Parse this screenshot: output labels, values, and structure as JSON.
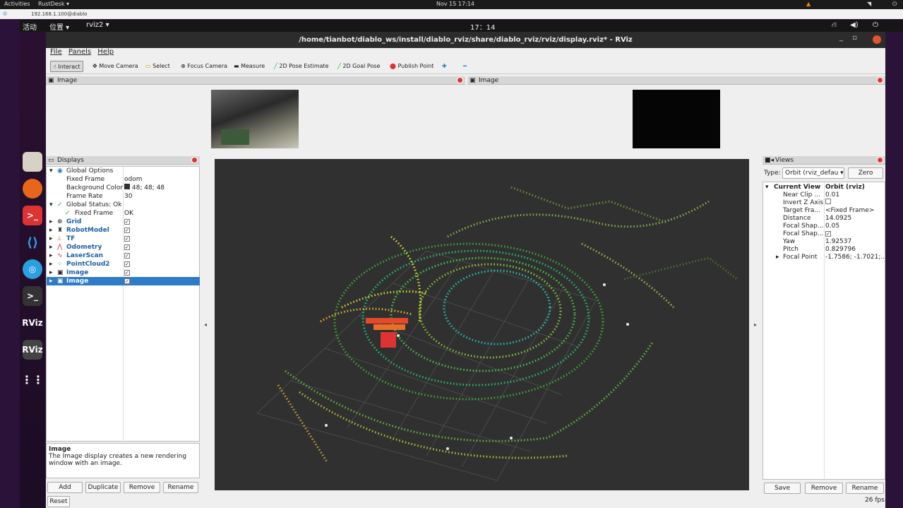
{
  "host": {
    "activities": "Activities",
    "app": "RustDesk ▾",
    "clock": "Nov 15  17:14",
    "address": "192.168.1.100@diablo"
  },
  "gnome": {
    "activities": "活动",
    "places": "位置 ▾",
    "app": "rviz2 ▾",
    "clock": "17：14"
  },
  "window": {
    "title": "/home/tianbot/diablo_ws/install/diablo_rviz/share/diablo_rviz/rviz/display.rviz* - RViz",
    "menu": [
      "File",
      "Panels",
      "Help"
    ],
    "tools": [
      "Interact",
      "Move Camera",
      "Select",
      "Focus Camera",
      "Measure",
      "2D Pose Estimate",
      "2D Goal Pose",
      "Publish Point"
    ]
  },
  "image_panels": [
    "Image",
    "Image"
  ],
  "displays": {
    "title": "Displays",
    "rows": [
      {
        "k": "Global Options",
        "v": ""
      },
      {
        "k": "Fixed Frame",
        "v": "odom"
      },
      {
        "k": "Background Color",
        "v": "48; 48; 48"
      },
      {
        "k": "Frame Rate",
        "v": "30"
      },
      {
        "k": "Global Status: Ok",
        "v": ""
      },
      {
        "k": "Fixed Frame",
        "v": "OK"
      },
      {
        "k": "Grid",
        "v": "✓"
      },
      {
        "k": "RobotModel",
        "v": "✓"
      },
      {
        "k": "TF",
        "v": "✓"
      },
      {
        "k": "Odometry",
        "v": "✓"
      },
      {
        "k": "LaserScan",
        "v": "✓"
      },
      {
        "k": "PointCloud2",
        "v": "✓"
      },
      {
        "k": "Image",
        "v": "✓"
      },
      {
        "k": "Image",
        "v": "✓"
      }
    ],
    "desc_title": "Image",
    "desc_text": "The Image display creates a new rendering window with an image.",
    "buttons": [
      "Add",
      "Duplicate",
      "Remove",
      "Rename"
    ],
    "reset": "Reset"
  },
  "views": {
    "title": "Views",
    "type_label": "Type:",
    "type_value": "Orbit (rviz_defau ▾",
    "zero": "Zero",
    "rows": [
      {
        "k": "Current View",
        "v": "Orbit (rviz)"
      },
      {
        "k": "Near Clip ...",
        "v": "0.01"
      },
      {
        "k": "Invert Z Axis",
        "v": ""
      },
      {
        "k": "Target Fra...",
        "v": "<Fixed Frame>"
      },
      {
        "k": "Distance",
        "v": "14.0925"
      },
      {
        "k": "Focal Shap...",
        "v": "0.05"
      },
      {
        "k": "Focal Shap...",
        "v": "✓"
      },
      {
        "k": "Yaw",
        "v": "1.92537"
      },
      {
        "k": "Pitch",
        "v": "0.829796"
      },
      {
        "k": "Focal Point",
        "v": "-1.7586; -1.7021;..."
      }
    ],
    "buttons": [
      "Save",
      "Remove",
      "Rename"
    ]
  },
  "status": {
    "fps": "26 fps"
  }
}
